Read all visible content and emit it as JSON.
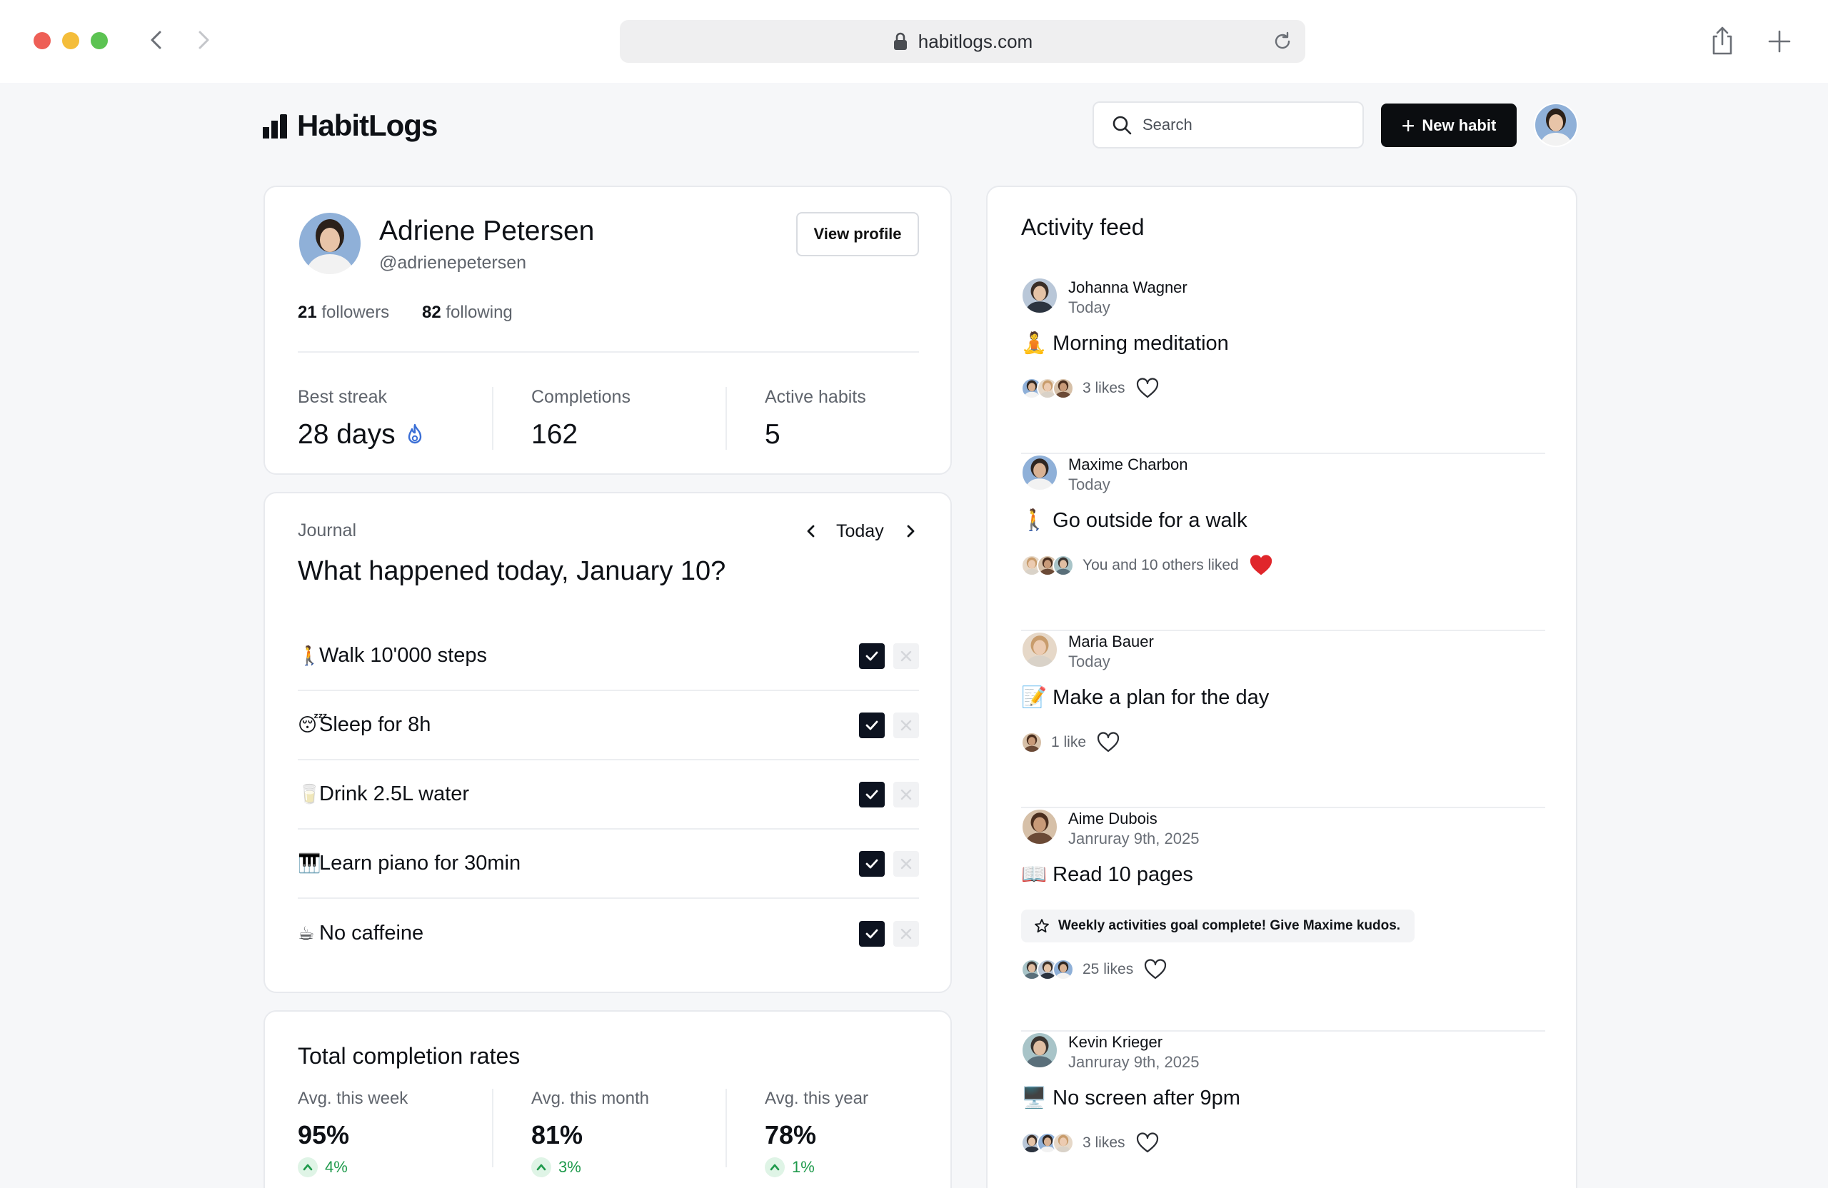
{
  "browser": {
    "url": "habitlogs.com"
  },
  "app": {
    "brand": "HabitLogs",
    "search_placeholder": "Search",
    "new_habit_label": "New habit"
  },
  "profile": {
    "name": "Adriene Petersen",
    "handle": "@adrienepetersen",
    "view_profile_label": "View profile",
    "followers_count": "21",
    "followers_label": "followers",
    "following_count": "82",
    "following_label": "following",
    "stats": [
      {
        "label": "Best streak",
        "value": "28 days"
      },
      {
        "label": "Completions",
        "value": "162"
      },
      {
        "label": "Active habits",
        "value": "5"
      }
    ]
  },
  "journal": {
    "label": "Journal",
    "title": "What happened today, January 10?",
    "nav_label": "Today",
    "habits": [
      {
        "emoji": "🚶",
        "text": "Walk 10'000 steps",
        "done": true
      },
      {
        "emoji": "😴",
        "text": "Sleep for 8h",
        "done": true
      },
      {
        "emoji": "🥛",
        "text": "Drink 2.5L water",
        "done": true
      },
      {
        "emoji": "🎹",
        "text": "Learn piano for 30min",
        "done": true
      },
      {
        "emoji": "☕",
        "text": "No caffeine",
        "done": true
      }
    ]
  },
  "rates": {
    "title": "Total completion rates",
    "items": [
      {
        "label": "Avg. this week",
        "value": "95%",
        "delta": "4%"
      },
      {
        "label": "Avg. this month",
        "value": "81%",
        "delta": "3%"
      },
      {
        "label": "Avg. this year",
        "value": "78%",
        "delta": "1%"
      }
    ]
  },
  "feed": {
    "title": "Activity feed",
    "items": [
      {
        "name": "Johanna Wagner",
        "date": "Today",
        "emoji": "🧘",
        "habit": "Morning meditation",
        "likes": "3 likes",
        "liked": false
      },
      {
        "name": "Maxime Charbon",
        "date": "Today",
        "emoji": "🚶",
        "habit": "Go outside for a walk",
        "likes": "You and 10 others liked",
        "liked": true
      },
      {
        "name": "Maria Bauer",
        "date": "Today",
        "emoji": "📝",
        "habit": "Make a plan for the day",
        "likes": "1 like",
        "liked": false
      },
      {
        "name": "Aime Dubois",
        "date": "Janruray 9th, 2025",
        "emoji": "📖",
        "habit": "Read 10 pages",
        "kudos": "Weekly activities goal complete! Give Maxime kudos.",
        "likes": "25 likes",
        "liked": false
      },
      {
        "name": "Kevin Krieger",
        "date": "Janruray 9th, 2025",
        "emoji": "🖥️",
        "habit": "No screen after 9pm",
        "likes": "3 likes",
        "liked": false
      }
    ]
  },
  "colors": {
    "accent": "#0b0d10",
    "positive": "#1f9a4c",
    "heart_liked": "#e0262b",
    "streak_icon": "#3b6fd6"
  }
}
